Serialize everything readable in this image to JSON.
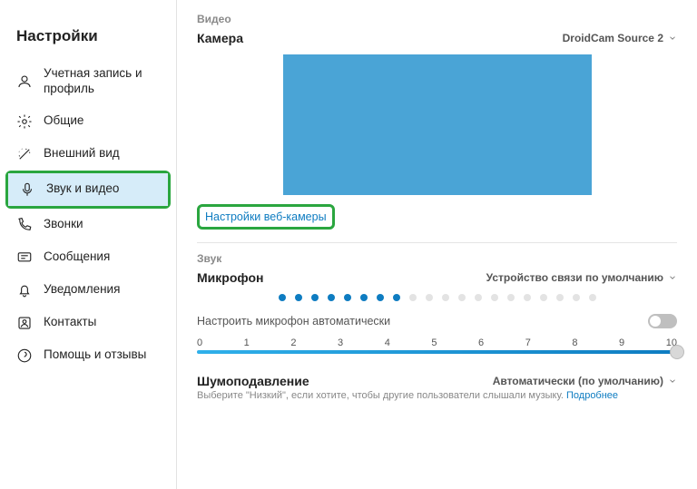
{
  "sidebar": {
    "title": "Настройки",
    "items": [
      {
        "label": "Учетная запись и профиль",
        "icon": "user-icon"
      },
      {
        "label": "Общие",
        "icon": "gear-icon"
      },
      {
        "label": "Внешний вид",
        "icon": "wand-icon"
      },
      {
        "label": "Звук и видео",
        "icon": "microphone-icon",
        "active": true,
        "highlighted": true
      },
      {
        "label": "Звонки",
        "icon": "phone-icon"
      },
      {
        "label": "Сообщения",
        "icon": "message-icon"
      },
      {
        "label": "Уведомления",
        "icon": "bell-icon"
      },
      {
        "label": "Контакты",
        "icon": "contacts-icon"
      },
      {
        "label": "Помощь и отзывы",
        "icon": "help-icon"
      }
    ]
  },
  "video": {
    "section_label": "Видео",
    "camera_label": "Камера",
    "camera_value": "DroidCam Source 2",
    "webcam_settings_link": "Настройки веб-камеры"
  },
  "audio": {
    "section_label": "Звук",
    "mic_label": "Микрофон",
    "mic_value": "Устройство связи по умолчанию",
    "mic_level_total": 20,
    "mic_level_active": 8,
    "auto_adjust_label": "Настроить микрофон автоматически",
    "auto_adjust_on": false,
    "slider_ticks": [
      "0",
      "1",
      "2",
      "3",
      "4",
      "5",
      "6",
      "7",
      "8",
      "9",
      "10"
    ],
    "slider_value": 10,
    "slider_max": 10
  },
  "noise": {
    "title": "Шумоподавление",
    "value": "Автоматически (по умолчанию)",
    "desc_prefix": "Выберите \"Низкий\", если хотите, чтобы другие пользователи слышали музыку. ",
    "more_link": "Подробнее"
  }
}
